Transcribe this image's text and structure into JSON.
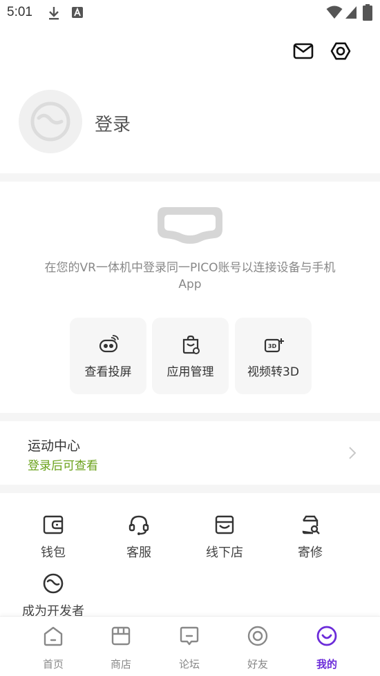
{
  "status_bar": {
    "time": "5:01"
  },
  "header": {
    "mail_icon": "mail-icon",
    "settings_icon": "settings-icon"
  },
  "profile": {
    "login_label": "登录"
  },
  "device": {
    "hint": "在您的VR一体机中登录同一PICO账号以连接设备与手机App",
    "features": [
      {
        "label": "查看投屏",
        "icon": "screencast-icon"
      },
      {
        "label": "应用管理",
        "icon": "app-manage-icon"
      },
      {
        "label": "视频转3D",
        "icon": "video-3d-icon"
      }
    ]
  },
  "sports": {
    "title": "运动中心",
    "subtitle": "登录后可查看",
    "subtitle_color": "#6aa11a"
  },
  "services": [
    {
      "label": "钱包",
      "icon": "wallet-icon"
    },
    {
      "label": "客服",
      "icon": "headset-service-icon"
    },
    {
      "label": "线下店",
      "icon": "store-icon"
    },
    {
      "label": "寄修",
      "icon": "repair-icon"
    },
    {
      "label": "成为开发者",
      "icon": "developer-icon"
    }
  ],
  "bottom_nav": {
    "active_color": "#6b2bd9",
    "items": [
      {
        "label": "首页",
        "icon": "home-icon"
      },
      {
        "label": "商店",
        "icon": "shop-icon"
      },
      {
        "label": "论坛",
        "icon": "forum-icon"
      },
      {
        "label": "好友",
        "icon": "friends-icon"
      },
      {
        "label": "我的",
        "icon": "me-icon",
        "active": true
      }
    ]
  }
}
